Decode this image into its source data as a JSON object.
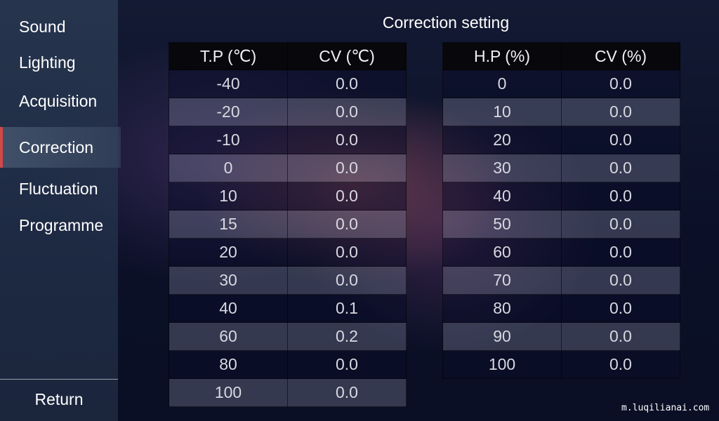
{
  "sidebar": {
    "items": [
      {
        "label": "Sound",
        "active": false
      },
      {
        "label": "Lighting",
        "active": false
      },
      {
        "label": "Acquisition",
        "active": false
      },
      {
        "label": "Correction",
        "active": true
      },
      {
        "label": "Fluctuation",
        "active": false
      },
      {
        "label": "Programme",
        "active": false
      }
    ],
    "return_label": "Return"
  },
  "main": {
    "title": "Correction setting",
    "temperature_table": {
      "headers": [
        "T.P (℃)",
        "CV (℃)"
      ],
      "rows": [
        [
          "-40",
          "0.0"
        ],
        [
          "-20",
          "0.0"
        ],
        [
          "-10",
          "0.0"
        ],
        [
          "0",
          "0.0"
        ],
        [
          "10",
          "0.0"
        ],
        [
          "15",
          "0.0"
        ],
        [
          "20",
          "0.0"
        ],
        [
          "30",
          "0.0"
        ],
        [
          "40",
          "0.1"
        ],
        [
          "60",
          "0.2"
        ],
        [
          "80",
          "0.0"
        ],
        [
          "100",
          "0.0"
        ]
      ]
    },
    "humidity_table": {
      "headers": [
        "H.P (%)",
        "CV (%)"
      ],
      "rows": [
        [
          "0",
          "0.0"
        ],
        [
          "10",
          "0.0"
        ],
        [
          "20",
          "0.0"
        ],
        [
          "30",
          "0.0"
        ],
        [
          "40",
          "0.0"
        ],
        [
          "50",
          "0.0"
        ],
        [
          "60",
          "0.0"
        ],
        [
          "70",
          "0.0"
        ],
        [
          "80",
          "0.0"
        ],
        [
          "90",
          "0.0"
        ],
        [
          "100",
          "0.0"
        ]
      ]
    }
  },
  "watermark": "m.luqilianai.com",
  "colors": {
    "active_indicator": "#d04848"
  }
}
